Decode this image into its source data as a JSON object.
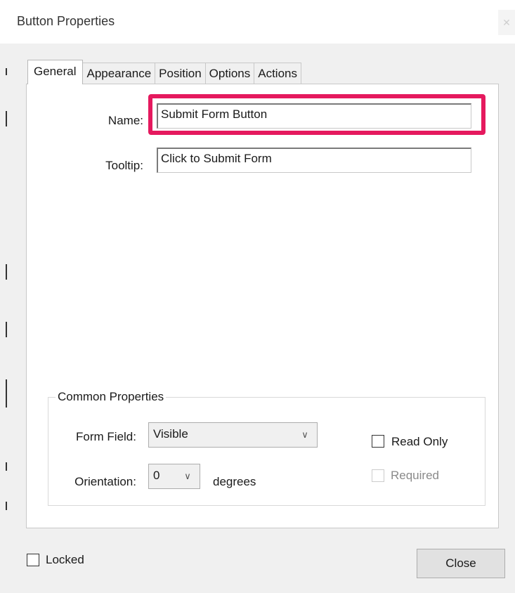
{
  "window": {
    "title": "Button Properties",
    "close_glyph": "✕"
  },
  "tabs": [
    {
      "label": "General",
      "active": true
    },
    {
      "label": "Appearance",
      "active": false
    },
    {
      "label": "Position",
      "active": false
    },
    {
      "label": "Options",
      "active": false
    },
    {
      "label": "Actions",
      "active": false
    }
  ],
  "general": {
    "name_label": "Name:",
    "name_value": "Submit Form Button",
    "tooltip_label": "Tooltip:",
    "tooltip_value": "Click to Submit Form"
  },
  "common_properties": {
    "title": "Common Properties",
    "form_field_label": "Form Field:",
    "form_field_value": "Visible",
    "orientation_label": "Orientation:",
    "orientation_value": "0",
    "degrees_label": "degrees",
    "read_only_label": "Read Only",
    "read_only_checked": false,
    "required_label": "Required",
    "required_checked": false,
    "required_enabled": false
  },
  "footer": {
    "locked_label": "Locked",
    "locked_checked": false,
    "close_label": "Close"
  },
  "colors": {
    "highlight": "#e5195e",
    "panel_background": "#ffffff",
    "dialog_background": "#f0f0f0"
  },
  "icons": {
    "dropdown": "chevron-down-icon",
    "window_close": "close-icon"
  }
}
